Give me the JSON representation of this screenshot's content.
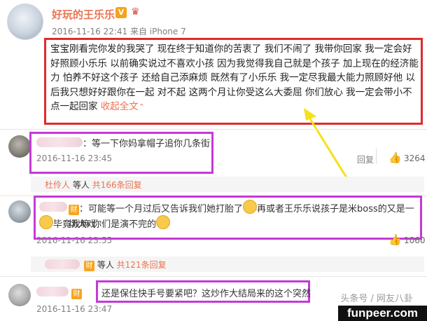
{
  "post": {
    "username": "好玩的王乐乐",
    "verified_badge": "V",
    "meta": "2016-11-16 22:41 来自 iPhone 7",
    "body": "宝宝刚看完你发的我哭了 现在终于知道你的苦衷了 我们不闹了 我带你回家 我一定会好好照顾小乐乐 以前确实说过不喜欢小孩 因为我觉得我自己就是个孩子 加上现在的经济能力 怕养不好这个孩子 还给自己添麻烦 既然有了小乐乐 我一定尽我最大能力照顾好他 以后我只想好好跟你在一起 对不起 这两个月让你受这么大委屈 你们放心 我一定会带小不点一起回家",
    "expand_label": "收起全文",
    "expand_arrow": "⌃"
  },
  "comments": [
    {
      "text": "：等一下你妈拿帽子追你几条街",
      "time": "2016-11-16 23:45",
      "reply_label": "回复",
      "likes": "3264",
      "sub_reply": {
        "user": "杜伶人",
        "suffix": "等人",
        "count_link": "共166条回复"
      }
    },
    {
      "fan_badge": "财",
      "text_a": "：可能等一个月过后又告诉我们她打胎了",
      "text_b": "再或者王乐乐说孩子是米boss的又是一场大戏",
      "text_c": "毕竟戏嘛 你们是演不完的",
      "time": "2016-11-16 23:55",
      "likes": "1060",
      "sub_reply": {
        "fan_badge": "财",
        "suffix": "等人",
        "count_link": "共121条回复"
      }
    },
    {
      "fan_badge": "财",
      "text": "还是保住快手号要紧吧？这炒作大结局来的这个突然",
      "time": "2016-11-16 23:47"
    }
  ],
  "watermark": "头条号 / 网友八卦",
  "site_tag": "funpeer.com",
  "colors": {
    "brand_orange": "#eb7350",
    "highlight_red": "#e02b2b",
    "highlight_magenta": "#c43ad6",
    "arrow_yellow": "#f5e11a"
  }
}
